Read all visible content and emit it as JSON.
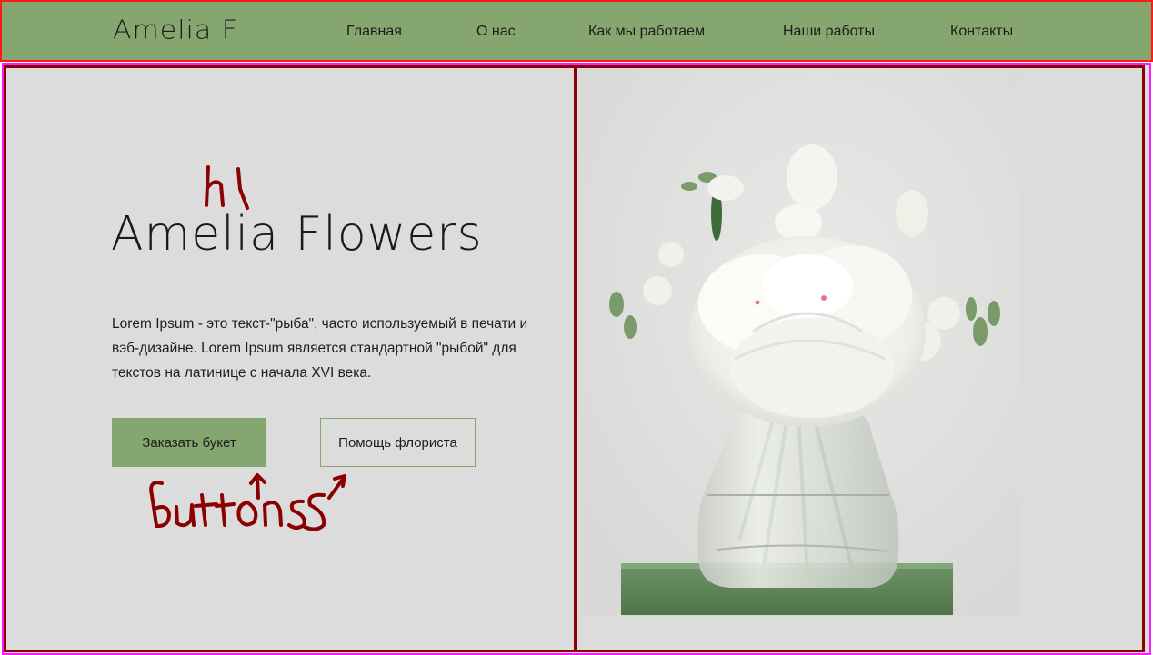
{
  "header": {
    "logo": "Amelia F",
    "nav": [
      {
        "label": "Главная"
      },
      {
        "label": "О нас"
      },
      {
        "label": "Как мы работаем"
      },
      {
        "label": "Наши работы"
      },
      {
        "label": "Контакты"
      }
    ]
  },
  "hero": {
    "title": "Amelia Flowers",
    "text": "Lorem Ipsum - это текст-\"рыба\", часто используемый в печати и вэб-дизайне. Lorem Ipsum является стандартной \"рыбой\" для текстов на латинице с начала XVI века.",
    "primary_button": "Заказать букет",
    "secondary_button": "Помощь флориста"
  },
  "annotations": {
    "h1_note": "h1",
    "buttons_note": "buttons"
  },
  "colors": {
    "accent_green": "#86a66f",
    "background_gray": "#dcdcdc",
    "annotation_red": "#8b0000",
    "header_outline": "#ff1a1a",
    "main_outline": "#ff19ff"
  },
  "icons": {
    "hero_image": "white-peony-bouquet-in-glass-vase-photo"
  }
}
